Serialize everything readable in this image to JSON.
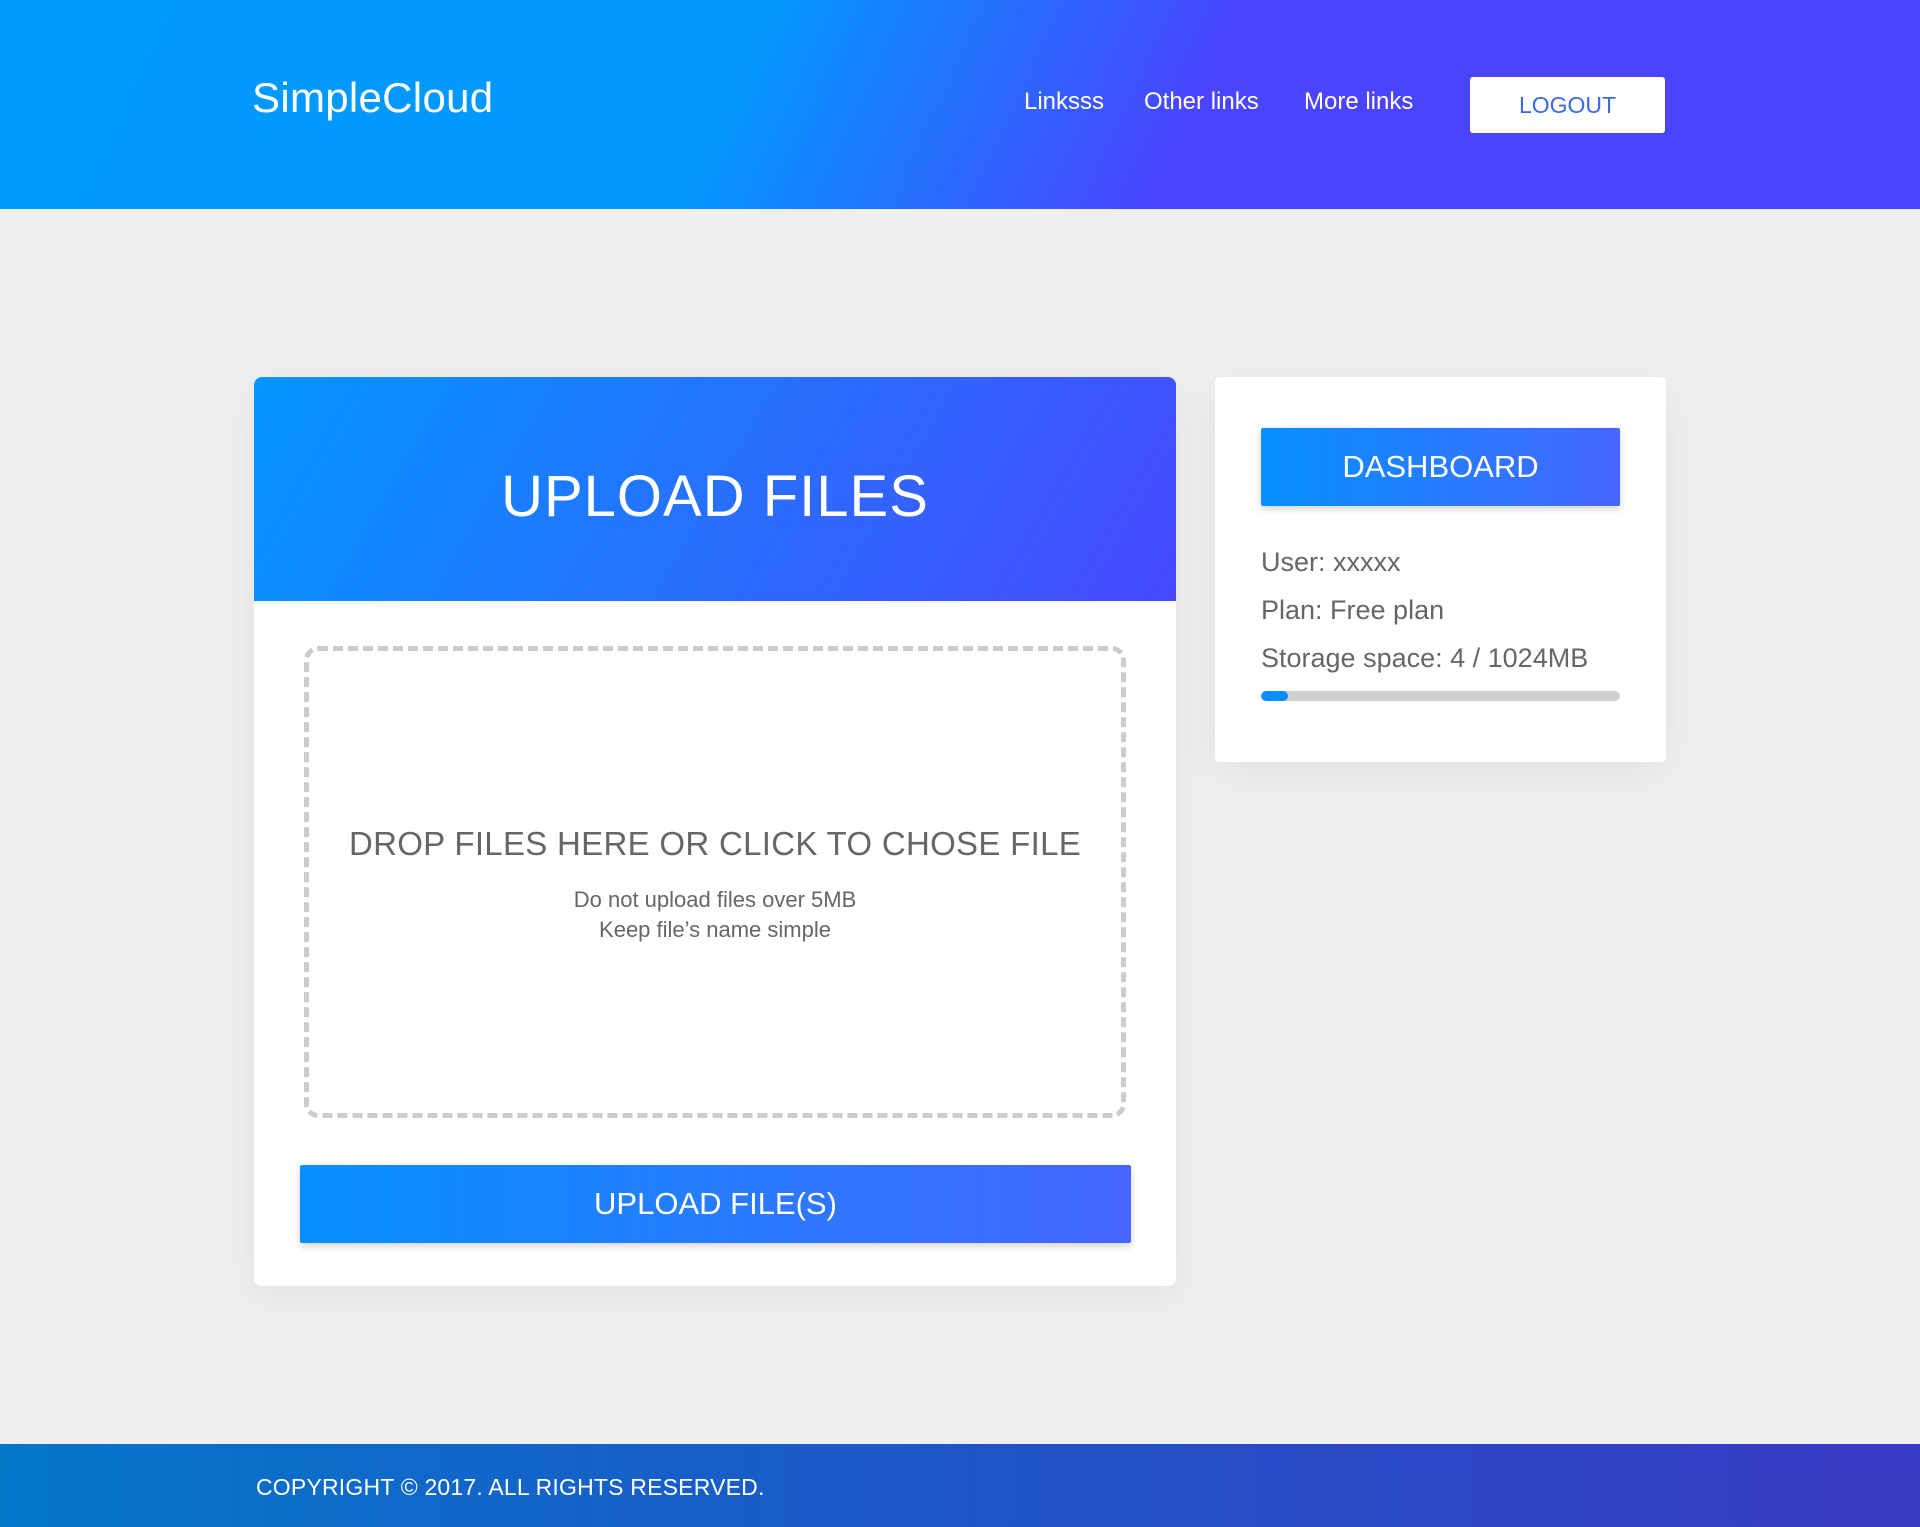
{
  "header": {
    "brand": "SimpleCloud",
    "nav": [
      "Linksss",
      "Other links",
      "More links"
    ],
    "logout_label": "LOGOUT"
  },
  "upload": {
    "title": "UPLOAD FILES",
    "drop_title": "DROP FILES HERE OR CLICK TO CHOSE FILE",
    "note_line1": "Do not upload files over 5MB",
    "note_line2": "Keep file’s name simple",
    "button_label": "UPLOAD FILE(S)"
  },
  "sidebar": {
    "dashboard_label": "DASHBOARD",
    "user": "User: xxxxx",
    "plan": "Plan: Free plan",
    "storage": "Storage space: 4 / 1024MB",
    "storage_used_fraction": 0.0039
  },
  "footer": {
    "copyright": "COPYRIGHT © 2017. ALL RIGHTS RESERVED."
  },
  "colors": {
    "accent": "#0396ff",
    "accent_end": "#4848ff",
    "background": "#efefef",
    "progress": "#0a8dff"
  }
}
